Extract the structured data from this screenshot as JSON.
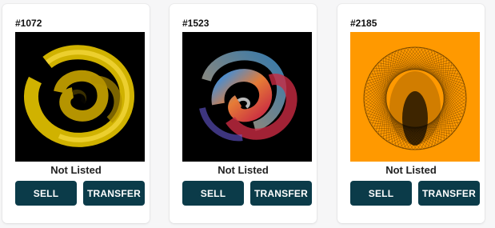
{
  "cards": [
    {
      "token_id": "#1072",
      "status": "Not Listed",
      "sell_label": "SELL",
      "transfer_label": "TRANSFER",
      "artwork_background": "#000000",
      "artwork_palette": [
        "#f5d100",
        "#c9a400",
        "#6b5600"
      ]
    },
    {
      "token_id": "#1523",
      "status": "Not Listed",
      "sell_label": "SELL",
      "transfer_label": "TRANSFER",
      "artwork_background": "#000000",
      "artwork_palette": [
        "#3aa0ff",
        "#ff8a3d",
        "#e0304a",
        "#ffffff"
      ]
    },
    {
      "token_id": "#2185",
      "status": "Not Listed",
      "sell_label": "SELL",
      "transfer_label": "TRANSFER",
      "artwork_background": "#ff9900",
      "artwork_palette": [
        "#000000"
      ]
    }
  ],
  "colors": {
    "button_bg": "#0b3b49",
    "button_text": "#ffffff",
    "page_bg": "#f6f6f7",
    "card_bg": "#ffffff"
  }
}
